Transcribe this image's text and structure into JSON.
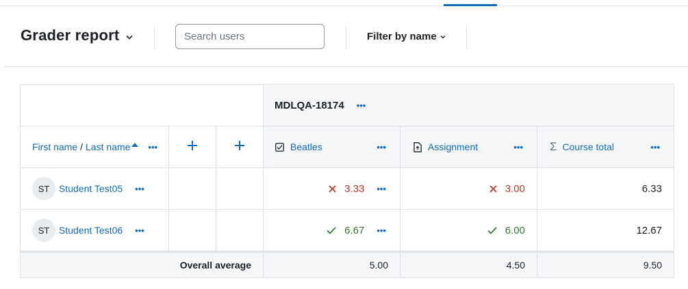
{
  "header": {
    "title": "Grader report",
    "search_placeholder": "Search users",
    "filter_label": "Filter by name"
  },
  "table": {
    "category_name": "MDLQA-18174",
    "columns": {
      "first_name": "First name",
      "separator": "/",
      "last_name": "Last name",
      "beatles": "Beatles",
      "assignment": "Assignment",
      "course_total": "Course total"
    },
    "rows": [
      {
        "initials": "ST",
        "name": "Student Test05",
        "beatles": "3.33",
        "beatles_status": "incorrect",
        "assignment": "3.00",
        "assignment_status": "incorrect",
        "course_total": "6.33"
      },
      {
        "initials": "ST",
        "name": "Student Test06",
        "beatles": "6.67",
        "beatles_status": "correct",
        "assignment": "6.00",
        "assignment_status": "correct",
        "course_total": "12.67"
      }
    ],
    "average": {
      "label": "Overall average",
      "beatles": "5.00",
      "assignment": "4.50",
      "course_total": "9.50"
    }
  },
  "colors": {
    "link": "#0f6cbf",
    "incorrect": "#ca3120",
    "correct": "#357a32",
    "header_bg": "#f5f6f8",
    "border": "#dee2e6"
  },
  "icons": [
    "caret-down-icon",
    "more-options-icon",
    "add-column-icon",
    "checkbox-icon",
    "assignment-icon",
    "sigma-icon",
    "cross-icon",
    "check-icon",
    "sort-asc-icon"
  ]
}
